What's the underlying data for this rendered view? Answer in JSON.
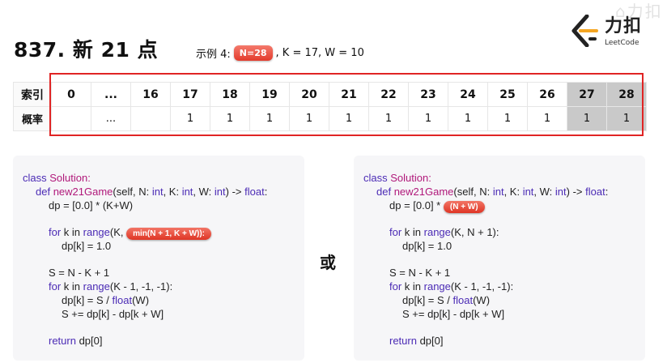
{
  "title": "837. 新 21 点",
  "example": {
    "prefix": "示例 4:",
    "highlight": "N=28",
    "suffix": ", K = 17, W = 10"
  },
  "logo": {
    "cn": "力扣",
    "en": "LeetCode",
    "watermark": "⌂力扣"
  },
  "table": {
    "row_headers": [
      "索引",
      "概率"
    ],
    "index": [
      "0",
      "...",
      "16",
      "17",
      "18",
      "19",
      "20",
      "21",
      "22",
      "23",
      "24",
      "25",
      "26",
      "27",
      "28"
    ],
    "prob": [
      "",
      "...",
      "",
      "1",
      "1",
      "1",
      "1",
      "1",
      "1",
      "1",
      "1",
      "1",
      "1",
      "1",
      "1"
    ]
  },
  "left_code": {
    "l1a": "class",
    "l1b": "Solution:",
    "l2a": "def",
    "l2b": "new21Game",
    "l2c": "(self, N: ",
    "l2d": "int",
    "l2e": ", K: ",
    "l2f": "int",
    "l2g": ", W: ",
    "l2h": "int",
    "l2i": ") -> ",
    "l2j": "float",
    "l2k": ":",
    "l3": "dp = [0.0] * (K+W)",
    "l4a": "for",
    "l4b": " k in ",
    "l4c": "range",
    "l4d": "(K, ",
    "l4pill": "min(N + 1, K + W)):",
    "l5": "dp[k] = 1.0",
    "l6": "S = N - K + 1",
    "l7a": "for",
    "l7b": " k in ",
    "l7c": "range",
    "l7d": "(K - 1, -1, -1):",
    "l8a": "dp[k] = S / ",
    "l8b": "float",
    "l8c": "(W)",
    "l9": "S += dp[k] - dp[k + W]",
    "l10a": "return",
    "l10b": " dp[0]"
  },
  "or_label": "或",
  "right_code": {
    "l3a": "dp = [0.0] * ",
    "l3pill": "(N + W)",
    "l4d": "(K, N + 1):"
  }
}
